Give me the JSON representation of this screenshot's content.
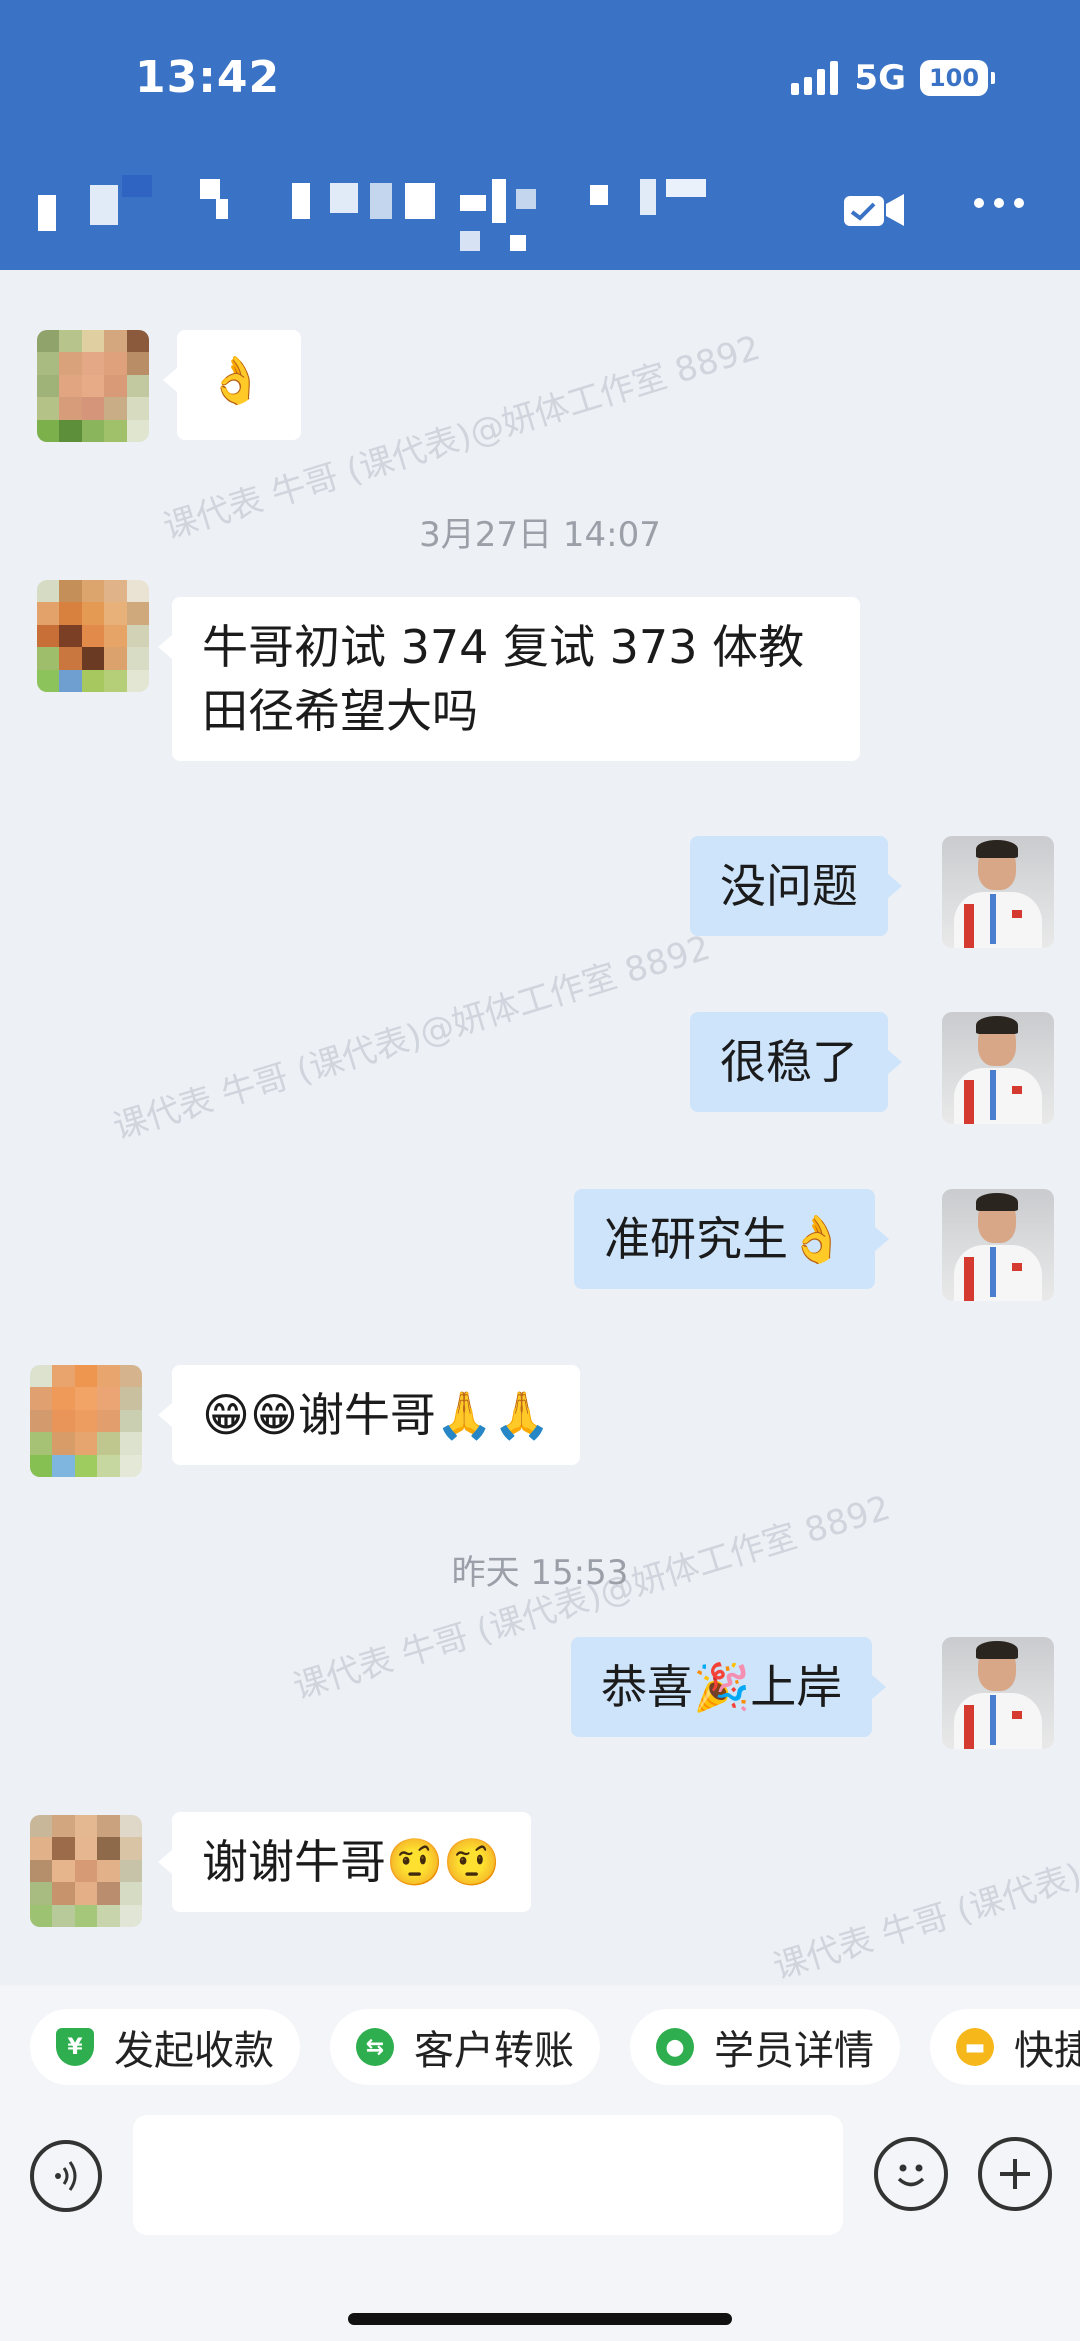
{
  "status_bar": {
    "time": "13:42",
    "network": "5G",
    "battery": "100"
  },
  "header": {
    "video_icon": "video-call-icon",
    "more_icon": "more-dots-icon",
    "colors": {
      "background": "#3a73c5"
    }
  },
  "watermark": {
    "text": "课代表 牛哥 (课代表)@妍体工作室 8892"
  },
  "messages": [
    {
      "side": "in",
      "text": "👌"
    },
    {
      "type": "time",
      "text": "3月27日 14:07"
    },
    {
      "side": "in",
      "text": "牛哥初试 374 复试 373 体教田径希望大吗"
    },
    {
      "side": "out",
      "text": "没问题"
    },
    {
      "side": "out",
      "text": "很稳了"
    },
    {
      "side": "out",
      "text": "准研究生👌"
    },
    {
      "side": "in",
      "text": "😁😁谢牛哥🙏🙏"
    },
    {
      "type": "time",
      "text": "昨天 15:53"
    },
    {
      "side": "out",
      "text": "恭喜🎉上岸"
    },
    {
      "side": "in",
      "text": "谢谢牛哥🤨🤨"
    }
  ],
  "quick_actions": [
    {
      "label": "发起收款",
      "icon": "receive-payment-icon",
      "color": "#2eae4e"
    },
    {
      "label": "客户转账",
      "icon": "transfer-icon",
      "color": "#2eae4e"
    },
    {
      "label": "学员详情",
      "icon": "student-info-icon",
      "color": "#2eae4e"
    },
    {
      "label": "快捷",
      "icon": "quick-reply-icon",
      "color": "#f5b71a"
    }
  ],
  "input_bar": {
    "placeholder": "",
    "voice_icon": "voice-icon",
    "emoji_icon": "emoji-icon",
    "plus_icon": "plus-icon"
  },
  "colors": {
    "chat_bg": "#edf0f5",
    "incoming_bubble": "#ffffff",
    "outgoing_bubble": "#cde4fb"
  }
}
